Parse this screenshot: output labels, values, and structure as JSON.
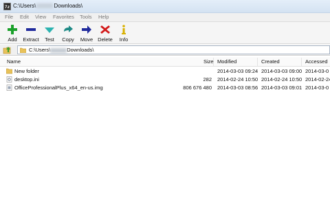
{
  "window": {
    "title_prefix": "C:\\Users\\",
    "title_suffix": "Downloads\\",
    "app_icon": "7z"
  },
  "menu": [
    "File",
    "Edit",
    "View",
    "Favorites",
    "Tools",
    "Help"
  ],
  "toolbar": [
    {
      "label": "Add",
      "icon": "plus-icon",
      "color": "#1aa02a"
    },
    {
      "label": "Extract",
      "icon": "minus-icon",
      "color": "#1f2a9c"
    },
    {
      "label": "Test",
      "icon": "check-arrow-icon",
      "color": "#2cb3b0"
    },
    {
      "label": "Copy",
      "icon": "copy-arrow-icon",
      "color": "#1f8a86"
    },
    {
      "label": "Move",
      "icon": "move-arrow-icon",
      "color": "#1f2a9c"
    },
    {
      "label": "Delete",
      "icon": "delete-x-icon",
      "color": "#d21a1a"
    },
    {
      "label": "Info",
      "icon": "info-icon",
      "color": "#d8b000"
    }
  ],
  "address": {
    "prefix": "C:\\Users\\",
    "suffix": "Downloads\\"
  },
  "columns": [
    "Name",
    "Size",
    "Modified",
    "Created",
    "Accessed"
  ],
  "files": [
    {
      "name": "New folder",
      "type": "folder",
      "size": "",
      "modified": "2014-03-03 09:24",
      "created": "2014-03-03 09:00",
      "accessed": "2014-03-0"
    },
    {
      "name": "desktop.ini",
      "type": "ini",
      "size": "282",
      "modified": "2014-02-24 10:50",
      "created": "2014-02-24 10:50",
      "accessed": "2014-02-24"
    },
    {
      "name": "OfficeProfessionalPlus_x64_en-us.img",
      "type": "img",
      "size": "806 676 480",
      "modified": "2014-03-03 08:56",
      "created": "2014-03-03 09:01",
      "accessed": "2014-03-0"
    }
  ]
}
